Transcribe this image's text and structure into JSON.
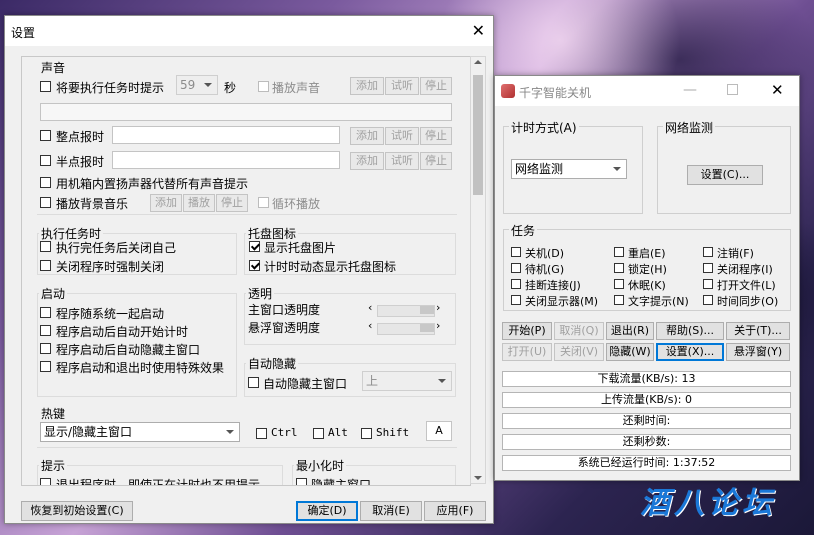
{
  "background": {
    "watermark": "酒八论坛"
  },
  "settings": {
    "title": "设置",
    "sound": {
      "group_title": "声音",
      "remind_before_label": "将要执行任务时提示",
      "remind_seconds": "59",
      "seconds_unit": "秒",
      "play_sound_label": "播放声音",
      "hourly_label": "整点报时",
      "half_hourly_label": "半点报时",
      "use_speaker_label": "用机箱内置扬声器代替所有声音提示",
      "bg_music_label": "播放背景音乐",
      "loop_label": "循环播放",
      "add": "添加",
      "listen": "试听",
      "stop": "停止",
      "play": "播放"
    },
    "exec": {
      "group_title": "执行任务时",
      "close_self": "执行完任务后关闭自己",
      "force_close": "关闭程序时强制关闭"
    },
    "tray": {
      "group_title": "托盘图标",
      "show_tray": "显示托盘图片",
      "dynamic_tray": "计时时动态显示托盘图标"
    },
    "startup": {
      "group_title": "启动",
      "with_system": "程序随系统一起启动",
      "auto_start": "程序启动后自动开始计时",
      "auto_hide": "程序启动后自动隐藏主窗口",
      "special_effect": "程序启动和退出时使用特殊效果"
    },
    "transparency": {
      "group_title": "透明",
      "main": "主窗口透明度",
      "float": "悬浮窗透明度"
    },
    "auto_hide": {
      "group_title": "自动隐藏",
      "label": "自动隐藏主窗口",
      "position": "上"
    },
    "hotkey": {
      "group_title": "热键",
      "action": "显示/隐藏主窗口",
      "ctrl": "Ctrl",
      "alt": "Alt",
      "shift": "Shift",
      "key": "A"
    },
    "tips": {
      "group_title": "提示",
      "exit_no_tip": "退出程序时，即使正在计时也不用提示"
    },
    "minimize": {
      "group_title": "最小化时",
      "hide_main": "隐藏主窗口"
    },
    "buttons": {
      "reset": "恢复到初始设置(C)",
      "ok": "确定(D)",
      "cancel": "取消(E)",
      "apply": "应用(F)"
    }
  },
  "main": {
    "title": "千字智能关机",
    "timing": {
      "label": "计时方式(A)",
      "value": "网络监测"
    },
    "network": {
      "label": "网络监测",
      "settings_button": "设置(C)..."
    },
    "tasks": {
      "group_title": "任务",
      "items": [
        "关机(D)",
        "重启(E)",
        "注销(F)",
        "待机(G)",
        "锁定(H)",
        "关闭程序(I)",
        "挂断连接(J)",
        "休眠(K)",
        "打开文件(L)",
        "关闭显示器(M)",
        "文字提示(N)",
        "时间同步(O)"
      ]
    },
    "buttons": [
      "开始(P)",
      "取消(Q)",
      "退出(R)",
      "帮助(S)...",
      "关于(T)...",
      "打开(U)",
      "关闭(V)",
      "隐藏(W)",
      "设置(X)...",
      "悬浮窗(Y)"
    ],
    "status": {
      "download": "下载流量(KB/s): 13",
      "upload": "上传流量(KB/s): 0",
      "remaining_time": "还剩时间:",
      "remaining_seconds": "还剩秒数:",
      "uptime": "系统已经运行时间: 1:37:52"
    }
  }
}
